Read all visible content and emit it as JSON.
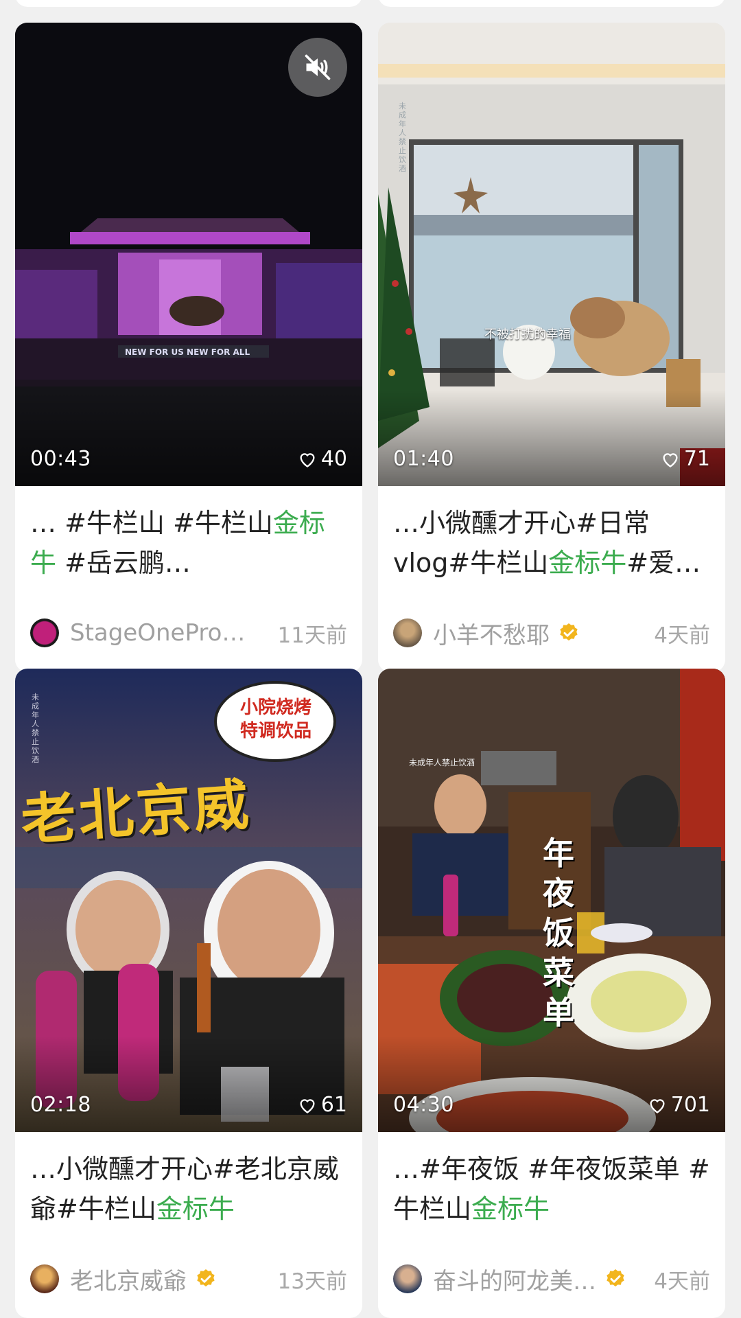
{
  "colors": {
    "accent": "#3cac4f",
    "verified": "#f2b51d"
  },
  "cards": [
    {
      "duration": "00:43",
      "likes": "40",
      "title_pre": "… #牛栏山 #牛栏山",
      "title_hl": "金标牛",
      "title_post": " #岳云鹏…",
      "author": "StageOnePro…",
      "time": "11天前",
      "muted_icon": "mute-icon",
      "thumb_text": "NEW FOR US NEW FOR ALL"
    },
    {
      "duration": "01:40",
      "likes": "71",
      "title_pre": "…小微醺才开心#日常vlog#牛栏山",
      "title_hl": "金标牛",
      "title_post": "#爱…",
      "author": "小羊不愁耶",
      "time": "4天前",
      "caption": "不被打扰的幸福",
      "side_note": "未成年人禁止饮酒"
    },
    {
      "duration": "02:18",
      "likes": "61",
      "title_pre": "…小微醺才开心#老北京威爺#牛栏山",
      "title_hl": "金标牛",
      "title_post": "",
      "author": "老北京威爺",
      "time": "13天前",
      "big_text": "老北京威",
      "bubble_text": "小院烧烤特调饮品",
      "side_note": "未成年人禁止饮酒"
    },
    {
      "duration": "04:30",
      "likes": "701",
      "title_pre": "…#年夜饭 #年夜饭菜单 #牛栏山",
      "title_hl": "金标牛",
      "title_post": "",
      "author": "奋斗的阿龙美…",
      "time": "4天前",
      "vertical_text": "年夜饭菜单",
      "side_note": "未成年人禁止饮酒"
    }
  ]
}
